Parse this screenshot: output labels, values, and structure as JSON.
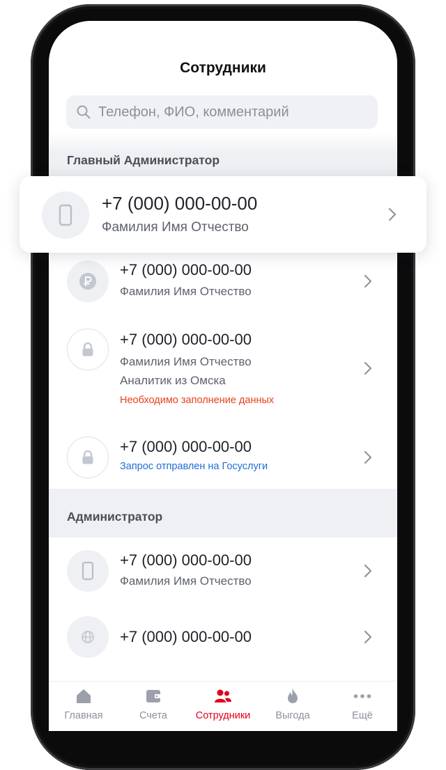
{
  "header": {
    "title": "Сотрудники"
  },
  "search": {
    "placeholder": "Телефон, ФИО, комментарий",
    "icon": "search-icon"
  },
  "sections": [
    {
      "title": "Главный Администратор"
    },
    {
      "title": "Администратор"
    }
  ],
  "highlighted_card": {
    "phone": "+7 (000) 000-00-00",
    "name": "Фамилия Имя Отчество",
    "icon": "smartphone-icon"
  },
  "employees": [
    {
      "phone": "+7 (000) 000-00-00",
      "name": "Фамилия Имя Отчество",
      "icon": "ruble-icon"
    },
    {
      "phone": "+7 (000) 000-00-00",
      "name": "Фамилия Имя Отчество",
      "comment": "Аналитик из Омска",
      "warning": "Необходимо заполнение данных",
      "icon": "lock-icon"
    },
    {
      "phone": "+7 (000) 000-00-00",
      "status": "Запрос отправлен на Госуслуги",
      "icon": "lock-icon"
    },
    {
      "phone": "+7 (000) 000-00-00",
      "name": "Фамилия Имя Отчество",
      "icon": "smartphone-icon"
    },
    {
      "phone": "+7 (000) 000-00-00",
      "icon": "globe-icon"
    }
  ],
  "tabbar": [
    {
      "label": "Главная",
      "icon": "home-icon"
    },
    {
      "label": "Счета",
      "icon": "wallet-icon"
    },
    {
      "label": "Сотрудники",
      "icon": "users-icon",
      "active": true
    },
    {
      "label": "Выгода",
      "icon": "flame-icon"
    },
    {
      "label": "Ещё",
      "icon": "more-icon"
    }
  ],
  "colors": {
    "accent": "#e3001b",
    "warning": "#e8401c",
    "info": "#1f6ed4",
    "section_bg": "#eef0f3",
    "search_bg": "#f0f1f4"
  }
}
